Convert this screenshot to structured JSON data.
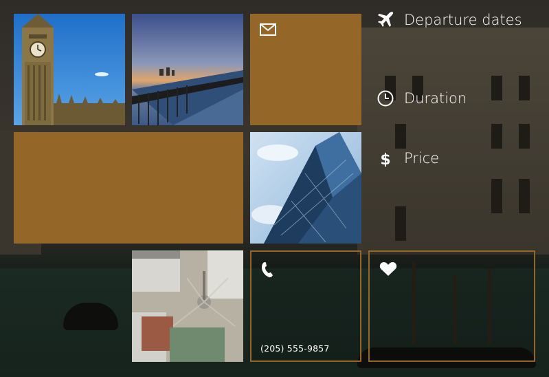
{
  "colors": {
    "accent": "#946627"
  },
  "menu": {
    "items": [
      {
        "label": "Departure dates",
        "icon": "airplane-icon"
      },
      {
        "label": "Duration",
        "icon": "clock-icon"
      },
      {
        "label": "Price",
        "icon": "dollar-icon"
      }
    ]
  },
  "tiles": {
    "mail": {
      "icon": "mail-icon"
    },
    "phone": {
      "icon": "phone-icon",
      "number": "(205) 555-9857"
    },
    "favorite": {
      "icon": "heart-icon"
    }
  }
}
